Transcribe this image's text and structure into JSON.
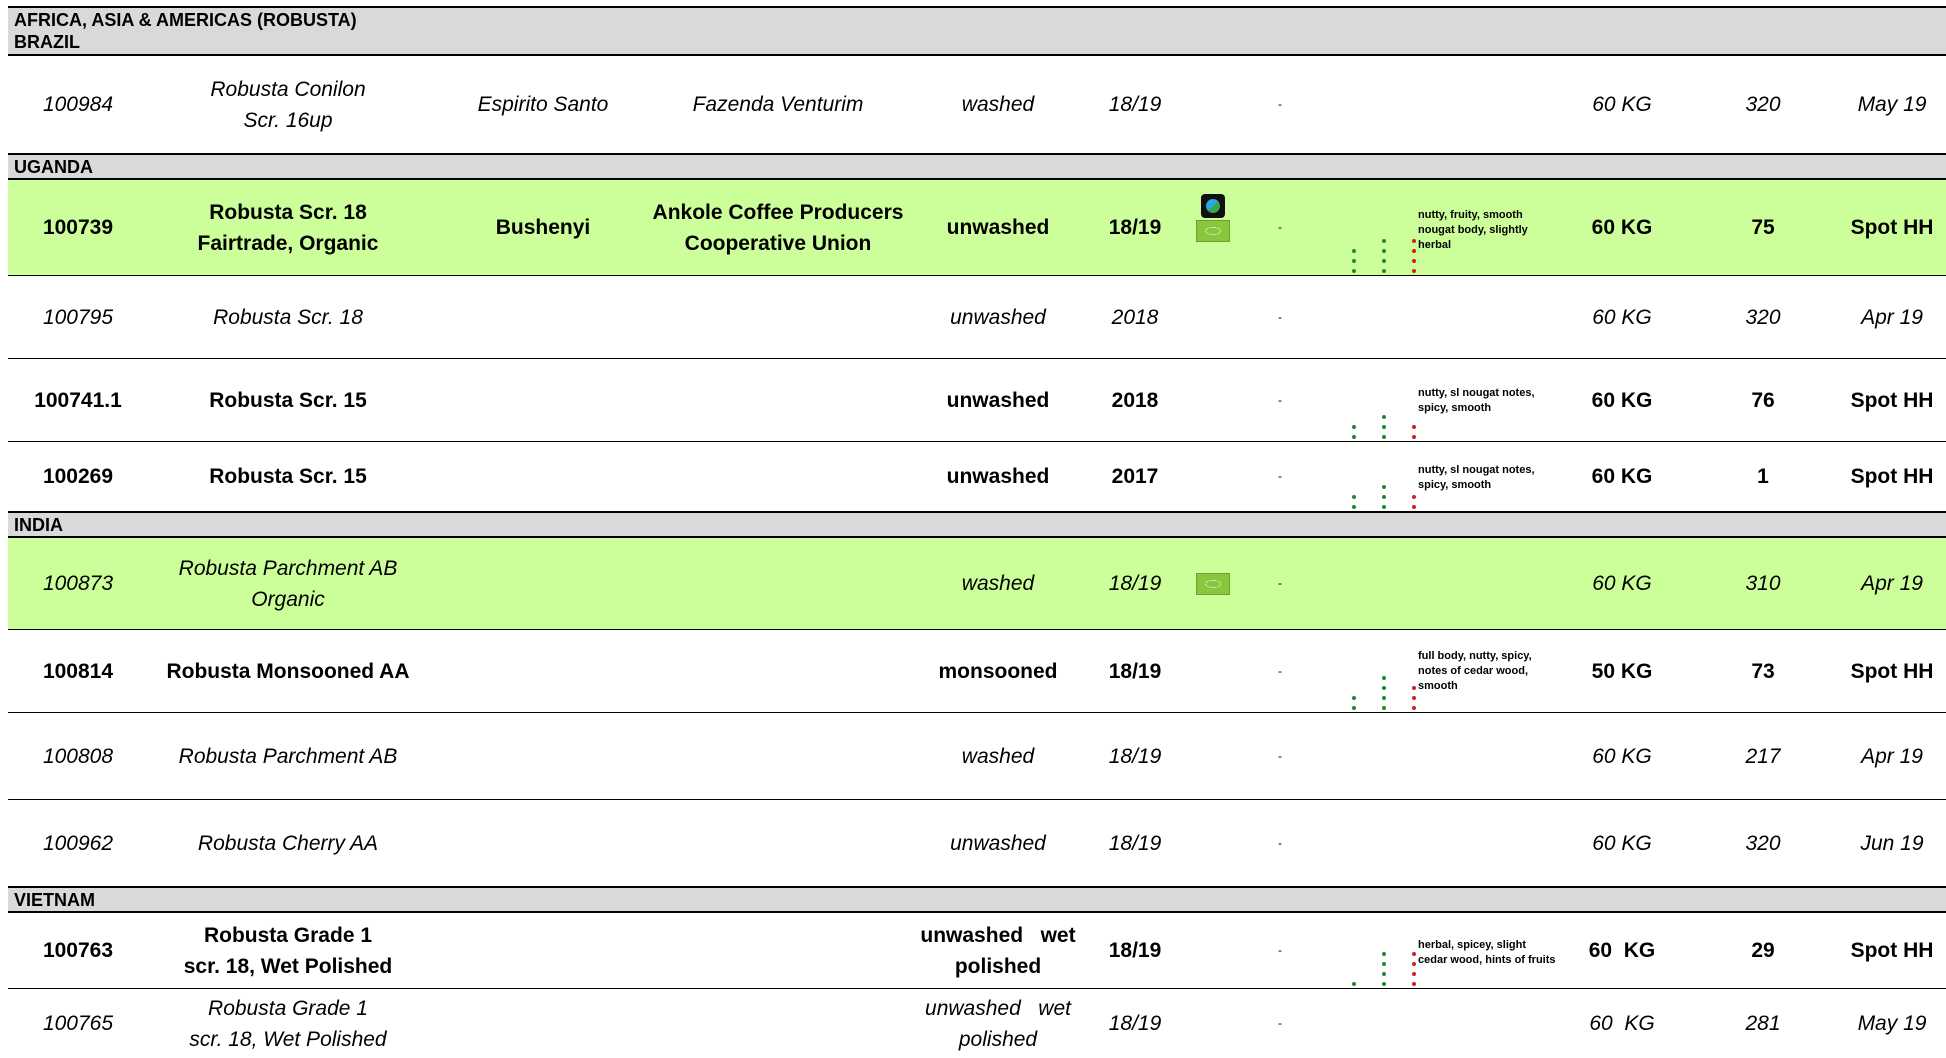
{
  "sheet_title": "AFRICA, ASIA & AMERICAS (ROBUSTA)",
  "sections": [
    {
      "name": "BRAZIL",
      "rows": [
        {
          "id": "100984",
          "desc1": "Robusta Conilon",
          "desc2": "Scr. 16up",
          "region": "Espirito Santo",
          "farm": "Fazenda Venturim",
          "proc1": "washed",
          "proc2": "",
          "crop": "18/19",
          "dash": "-",
          "notes": "",
          "bag": "60 KG",
          "qty": "320",
          "avail": "May 19"
        }
      ]
    },
    {
      "name": "UGANDA",
      "rows": [
        {
          "id": "100739",
          "desc1": "Robusta Scr. 18",
          "desc2": "Fairtrade, Organic",
          "region": "Bushenyi",
          "farm": "Ankole Coffee Producers Cooperative Union",
          "proc1": "unwashed",
          "proc2": "",
          "crop": "18/19",
          "dash": "-",
          "notes": "nutty, fruity, smooth nougat body, slightly herbal",
          "bag": "60 KG",
          "qty": "75",
          "avail": "Spot HH"
        },
        {
          "id": "100795",
          "desc1": "Robusta Scr. 18",
          "desc2": "",
          "region": "",
          "farm": "",
          "proc1": "unwashed",
          "proc2": "",
          "crop": "2018",
          "dash": "-",
          "notes": "",
          "bag": "60 KG",
          "qty": "320",
          "avail": "Apr 19"
        },
        {
          "id": "100741.1",
          "desc1": "Robusta Scr. 15",
          "desc2": "",
          "region": "",
          "farm": "",
          "proc1": "unwashed",
          "proc2": "",
          "crop": "2018",
          "dash": "-",
          "notes": "nutty, sl nougat notes, spicy,  smooth",
          "bag": "60 KG",
          "qty": "76",
          "avail": "Spot HH"
        },
        {
          "id": "100269",
          "desc1": "Robusta Scr. 15",
          "desc2": "",
          "region": "",
          "farm": "",
          "proc1": "unwashed",
          "proc2": "",
          "crop": "2017",
          "dash": "-",
          "notes": "nutty, sl nougat notes, spicy,  smooth",
          "bag": "60 KG",
          "qty": "1",
          "avail": "Spot HH"
        }
      ]
    },
    {
      "name": "INDIA",
      "rows": [
        {
          "id": "100873",
          "desc1": "Robusta Parchment AB",
          "desc2": "Organic",
          "region": "",
          "farm": "",
          "proc1": "washed",
          "proc2": "",
          "crop": "18/19",
          "dash": "-",
          "notes": "",
          "bag": "60 KG",
          "qty": "310",
          "avail": "Apr 19"
        },
        {
          "id": "100814",
          "desc1": "Robusta Monsooned AA",
          "desc2": "",
          "region": "",
          "farm": "",
          "proc1": "monsooned",
          "proc2": "",
          "crop": "18/19",
          "dash": "-",
          "notes": "full body, nutty, spicy, notes of cedar wood, smooth",
          "bag": "50 KG",
          "qty": "73",
          "avail": "Spot HH"
        },
        {
          "id": "100808",
          "desc1": "Robusta Parchment AB",
          "desc2": "",
          "region": "",
          "farm": "",
          "proc1": "washed",
          "proc2": "",
          "crop": "18/19",
          "dash": "-",
          "notes": "",
          "bag": "60 KG",
          "qty": "217",
          "avail": "Apr 19"
        },
        {
          "id": "100962",
          "desc1": "Robusta Cherry AA",
          "desc2": "",
          "region": "",
          "farm": "",
          "proc1": "unwashed",
          "proc2": "",
          "crop": "18/19",
          "dash": "-",
          "notes": "",
          "bag": "60 KG",
          "qty": "320",
          "avail": "Jun 19"
        }
      ]
    },
    {
      "name": "VIETNAM",
      "rows": [
        {
          "id": "100763",
          "desc1": "Robusta Grade 1",
          "desc2": "scr. 18, Wet Polished",
          "region": "",
          "farm": "",
          "proc1": "unwashed   wet",
          "proc2": "polished",
          "crop": "18/19",
          "dash": "-",
          "notes": "herbal, spicey, slight cedar wood, hints of fruits",
          "bag": "60  KG",
          "qty": "29",
          "avail": "Spot HH"
        },
        {
          "id": "100765",
          "desc1": "Robusta Grade 1",
          "desc2": "scr. 18, Wet Polished",
          "region": "",
          "farm": "",
          "proc1": "unwashed   wet",
          "proc2": "polished",
          "crop": "18/19",
          "dash": "-",
          "notes": "",
          "bag": "60  KG",
          "qty": "281",
          "avail": "May 19"
        }
      ]
    }
  ],
  "icons": {
    "fairtrade": "fairtrade-icon",
    "organic": "eu-organic-leaf-icon"
  },
  "colors": {
    "section_bg": "#d9d9d9",
    "highlight_row": "#ccff99",
    "dot_green": "#1f8a2e",
    "dot_red": "#d02020"
  }
}
